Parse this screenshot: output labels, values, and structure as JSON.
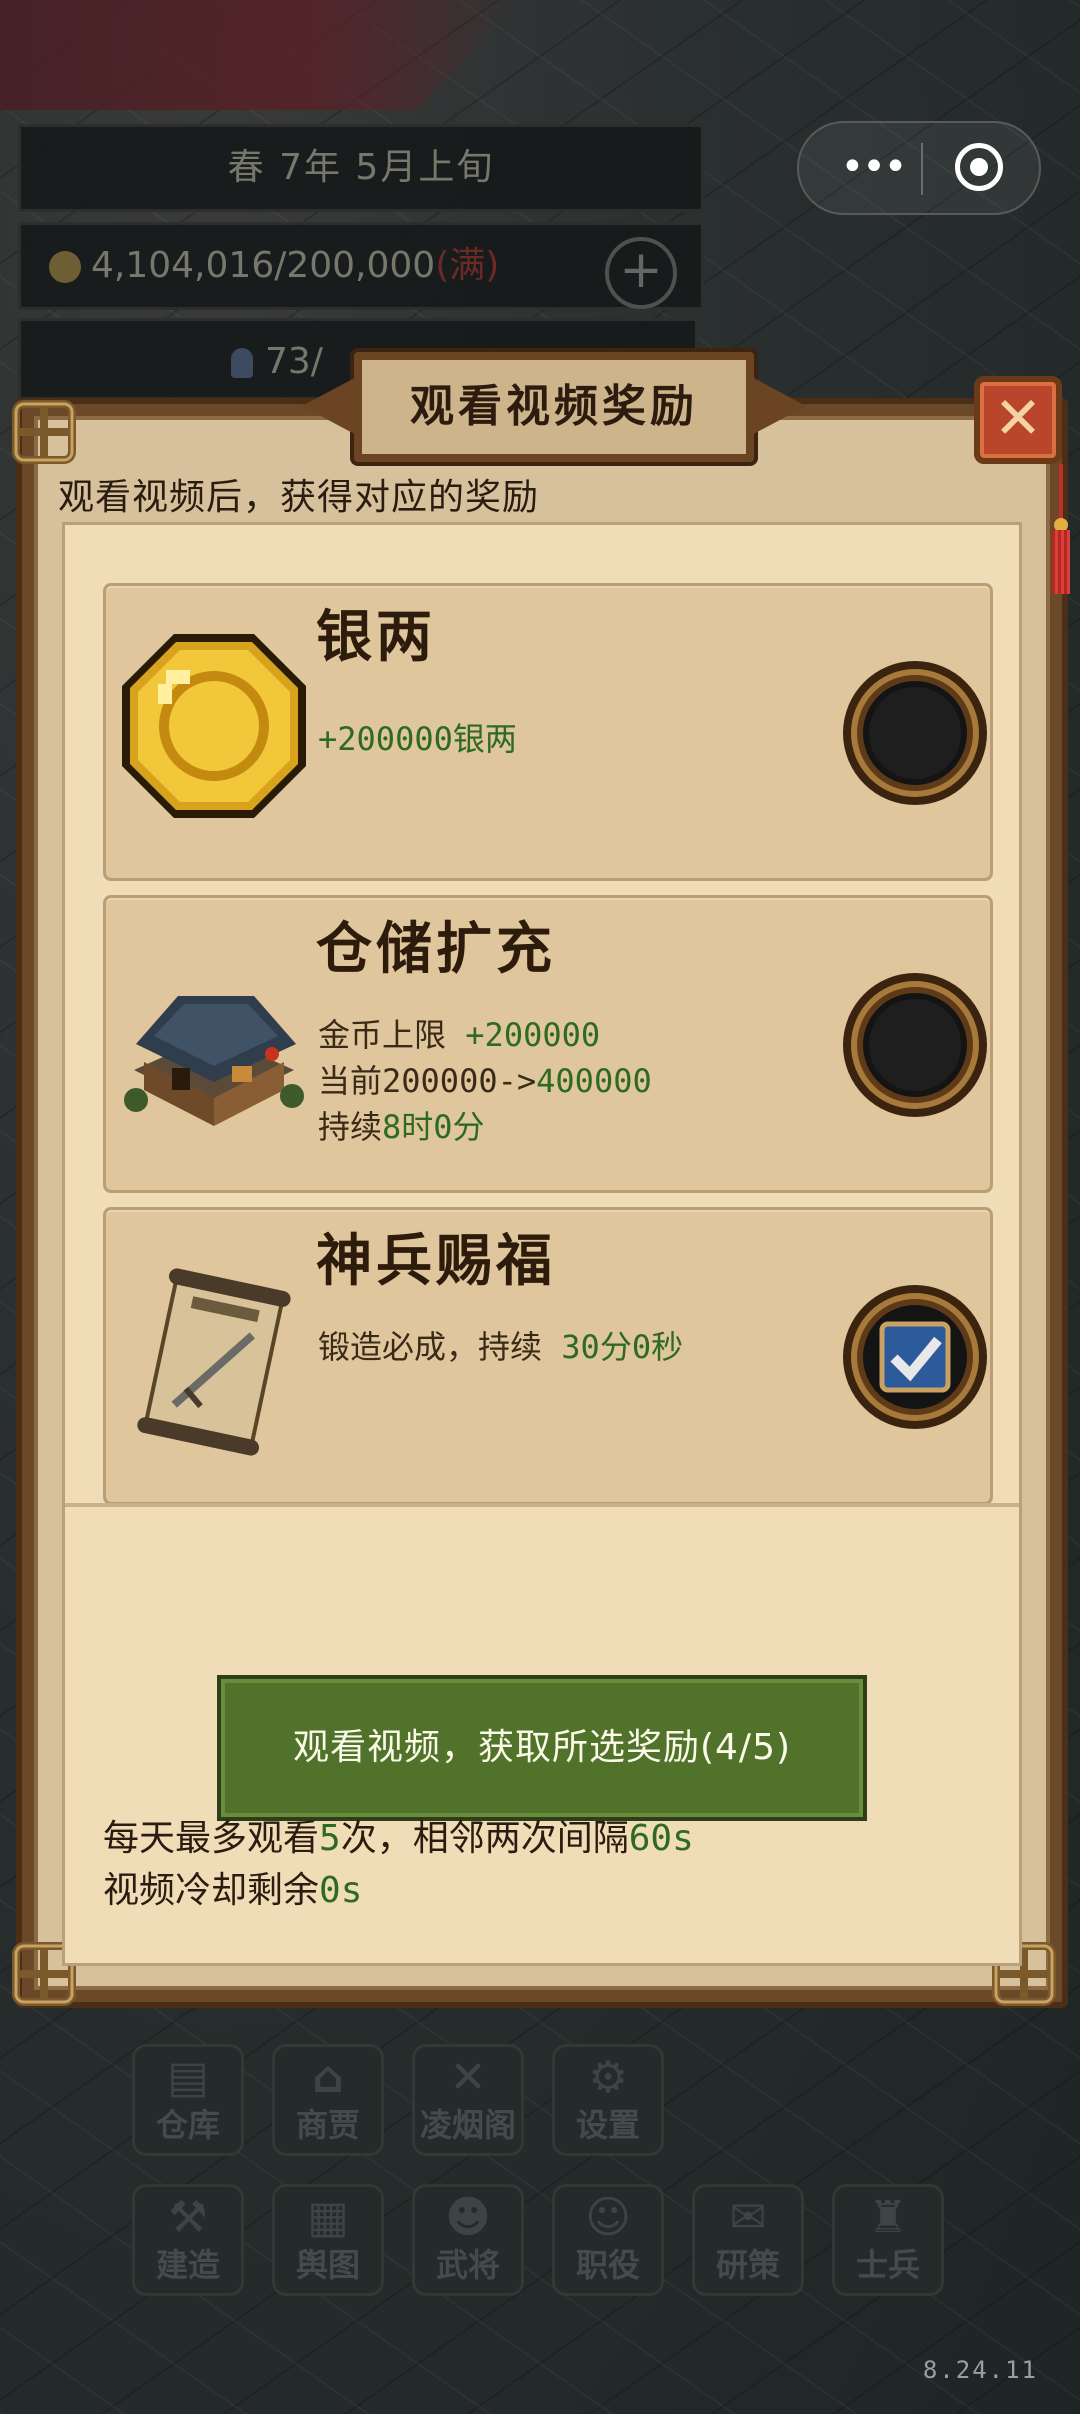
{
  "background": {
    "season_date": "春  7年  5月上旬",
    "gold": "4,104,016/200,000",
    "gold_full": "(满)",
    "population": "73/"
  },
  "menu": {
    "row1": [
      {
        "label": "仓库",
        "icon": "warehouse-icon"
      },
      {
        "label": "商贾",
        "icon": "market-icon"
      },
      {
        "label": "凌烟阁",
        "icon": "crossed-swords-icon"
      },
      {
        "label": "设置",
        "icon": "gear-icon"
      }
    ],
    "row2": [
      {
        "label": "建造",
        "icon": "hammer-icon"
      },
      {
        "label": "舆图",
        "icon": "map-icon"
      },
      {
        "label": "武将",
        "icon": "generals-icon"
      },
      {
        "label": "职役",
        "icon": "worker-icon"
      },
      {
        "label": "研策",
        "icon": "scroll-icon"
      },
      {
        "label": "士兵",
        "icon": "soldier-icon"
      }
    ]
  },
  "version": "8.24.11",
  "dialog": {
    "title": "观看视频奖励",
    "subtitle": "观看视频后，获得对应的奖励",
    "rewards": [
      {
        "name": "银两",
        "icon": "gold-coin-icon",
        "lines": [
          [
            "+200000银两",
            ""
          ]
        ],
        "selected": false
      },
      {
        "name": "仓储扩充",
        "icon": "storehouse-icon",
        "line1_label": "金币上限 ",
        "line1_value": "+200000",
        "line2_label": "当前200000->",
        "line2_value": "400000",
        "line3_label": "持续",
        "line3_value": "8时0分",
        "selected": false
      },
      {
        "name": "神兵赐福",
        "icon": "forging-scroll-icon",
        "line1_label": "锻造必成，持续 ",
        "line1_value": "30分0秒",
        "selected": true
      }
    ],
    "coin_amount": "+200000银两",
    "watch_button": "观看视频，获取所选奖励(4/5)",
    "note1_a": "每天最多观看",
    "note1_b": "5",
    "note1_c": "次，相邻两次间隔",
    "note1_d": "60s",
    "note2_a": "视频冷却剩余",
    "note2_b": "0s"
  },
  "colors": {
    "accent_green": "#51722b",
    "value_green": "#2e6a22",
    "close_red": "#b9452a",
    "parchment": "#f0dcb6"
  }
}
